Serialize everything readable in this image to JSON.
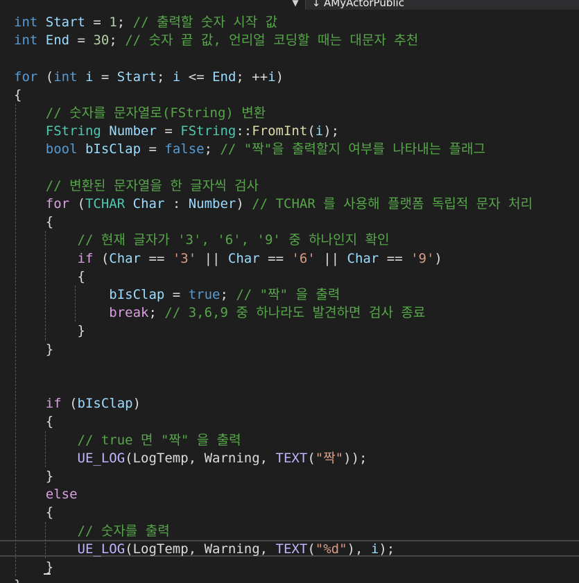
{
  "navbar": {
    "dropdown_icon": "caret-down-icon",
    "member_arrow_icon": "arrow-down-icon",
    "member_label": "AMyActorPublic"
  },
  "theme": {
    "background": "#1e1e1e",
    "keyword": "#569cd6",
    "type": "#4ec9b0",
    "variable": "#9cdcfe",
    "number": "#b5cea8",
    "string": "#d69d85",
    "comment": "#57a64a",
    "function": "#dcdcaa",
    "control": "#d8a0df",
    "macro": "#beb7ff",
    "plain": "#dcdcdc"
  },
  "code": {
    "lines": [
      [
        [
          "kw",
          "int"
        ],
        [
          "pl",
          " "
        ],
        [
          "var",
          "Start"
        ],
        [
          "pl",
          " = "
        ],
        [
          "num",
          "1"
        ],
        [
          "pl",
          "; "
        ],
        [
          "cmt",
          "// 출력할 숫자 시작 값"
        ]
      ],
      [
        [
          "kw",
          "int"
        ],
        [
          "pl",
          " "
        ],
        [
          "var",
          "End"
        ],
        [
          "pl",
          " = "
        ],
        [
          "num",
          "30"
        ],
        [
          "pl",
          "; "
        ],
        [
          "cmt",
          "// 숫자 끝 값, 언리얼 코딩할 때는 대문자 추천"
        ]
      ],
      [],
      [
        [
          "kw",
          "for"
        ],
        [
          "pl",
          " ("
        ],
        [
          "kw",
          "int"
        ],
        [
          "pl",
          " "
        ],
        [
          "var",
          "i"
        ],
        [
          "pl",
          " = "
        ],
        [
          "var",
          "Start"
        ],
        [
          "pl",
          "; "
        ],
        [
          "var",
          "i"
        ],
        [
          "pl",
          " <= "
        ],
        [
          "var",
          "End"
        ],
        [
          "pl",
          "; ++"
        ],
        [
          "var",
          "i"
        ],
        [
          "pl",
          ")"
        ]
      ],
      [
        [
          "pl",
          "{"
        ]
      ],
      [
        [
          "pl",
          "    "
        ],
        [
          "cmt",
          "// 숫자를 문자열로(FString) 변환"
        ]
      ],
      [
        [
          "pl",
          "    "
        ],
        [
          "typ",
          "FString"
        ],
        [
          "pl",
          " "
        ],
        [
          "var",
          "Number"
        ],
        [
          "pl",
          " = "
        ],
        [
          "typ",
          "FString"
        ],
        [
          "pl",
          "::"
        ],
        [
          "fn",
          "FromInt"
        ],
        [
          "pl",
          "("
        ],
        [
          "var",
          "i"
        ],
        [
          "pl",
          ");"
        ]
      ],
      [
        [
          "pl",
          "    "
        ],
        [
          "kw",
          "bool"
        ],
        [
          "pl",
          " "
        ],
        [
          "var",
          "bIsClap"
        ],
        [
          "pl",
          " = "
        ],
        [
          "kw",
          "false"
        ],
        [
          "pl",
          "; "
        ],
        [
          "cmt",
          "// \"짝\"을 출력할지 여부를 나타내는 플래그"
        ]
      ],
      [],
      [
        [
          "pl",
          "    "
        ],
        [
          "cmt",
          "// 변환된 문자열을 한 글자씩 검사"
        ]
      ],
      [
        [
          "pl",
          "    "
        ],
        [
          "ctl",
          "for"
        ],
        [
          "pl",
          " ("
        ],
        [
          "typ",
          "TCHAR"
        ],
        [
          "pl",
          " "
        ],
        [
          "var",
          "Char"
        ],
        [
          "pl",
          " : "
        ],
        [
          "var",
          "Number"
        ],
        [
          "pl",
          ") "
        ],
        [
          "cmt",
          "// TCHAR 를 사용해 플랫폼 독립적 문자 처리"
        ]
      ],
      [
        [
          "pl",
          "    {"
        ]
      ],
      [
        [
          "pl",
          "        "
        ],
        [
          "cmt",
          "// 현재 글자가 '3', '6', '9' 중 하나인지 확인"
        ]
      ],
      [
        [
          "pl",
          "        "
        ],
        [
          "ctl",
          "if"
        ],
        [
          "pl",
          " ("
        ],
        [
          "var",
          "Char"
        ],
        [
          "pl",
          " == "
        ],
        [
          "str",
          "'3'"
        ],
        [
          "pl",
          " || "
        ],
        [
          "var",
          "Char"
        ],
        [
          "pl",
          " == "
        ],
        [
          "str",
          "'6'"
        ],
        [
          "pl",
          " || "
        ],
        [
          "var",
          "Char"
        ],
        [
          "pl",
          " == "
        ],
        [
          "str",
          "'9'"
        ],
        [
          "pl",
          ")"
        ]
      ],
      [
        [
          "pl",
          "        {"
        ]
      ],
      [
        [
          "pl",
          "            "
        ],
        [
          "var",
          "bIsClap"
        ],
        [
          "pl",
          " = "
        ],
        [
          "kw",
          "true"
        ],
        [
          "pl",
          "; "
        ],
        [
          "cmt",
          "// \"짝\" 을 출력"
        ]
      ],
      [
        [
          "pl",
          "            "
        ],
        [
          "ctl",
          "break"
        ],
        [
          "pl",
          "; "
        ],
        [
          "cmt",
          "// 3,6,9 중 하나라도 발견하면 검사 종료"
        ]
      ],
      [
        [
          "pl",
          "        }"
        ]
      ],
      [
        [
          "pl",
          "    }"
        ]
      ],
      [],
      [],
      [
        [
          "pl",
          "    "
        ],
        [
          "ctl",
          "if"
        ],
        [
          "pl",
          " ("
        ],
        [
          "var",
          "bIsClap"
        ],
        [
          "pl",
          ")"
        ]
      ],
      [
        [
          "pl",
          "    {"
        ]
      ],
      [
        [
          "pl",
          "        "
        ],
        [
          "cmt",
          "// true 면 \"짝\" 을 출력"
        ]
      ],
      [
        [
          "pl",
          "        "
        ],
        [
          "mac",
          "UE_LOG"
        ],
        [
          "pl",
          "("
        ],
        [
          "pl",
          "LogTemp"
        ],
        [
          "pl",
          ", "
        ],
        [
          "pl",
          "Warning"
        ],
        [
          "pl",
          ", "
        ],
        [
          "mac",
          "TEXT"
        ],
        [
          "pl",
          "("
        ],
        [
          "str",
          "\"짝\""
        ],
        [
          "pl",
          "));"
        ]
      ],
      [
        [
          "pl",
          "    }"
        ]
      ],
      [
        [
          "pl",
          "    "
        ],
        [
          "ctl",
          "else"
        ]
      ],
      [
        [
          "pl",
          "    {"
        ]
      ],
      [
        [
          "pl",
          "        "
        ],
        [
          "cmt",
          "// 숫자를 출력"
        ]
      ],
      [
        [
          "pl",
          "        "
        ],
        [
          "mac",
          "UE_LOG"
        ],
        [
          "pl",
          "("
        ],
        [
          "pl",
          "LogTemp"
        ],
        [
          "pl",
          ", "
        ],
        [
          "pl",
          "Warning"
        ],
        [
          "pl",
          ", "
        ],
        [
          "mac",
          "TEXT"
        ],
        [
          "pl",
          "("
        ],
        [
          "str",
          "\"%d\""
        ],
        [
          "pl",
          "), "
        ],
        [
          "var",
          "i"
        ],
        [
          "pl",
          ");"
        ]
      ],
      [
        [
          "pl",
          "    }"
        ]
      ],
      [
        [
          "pl",
          "}"
        ]
      ]
    ]
  }
}
